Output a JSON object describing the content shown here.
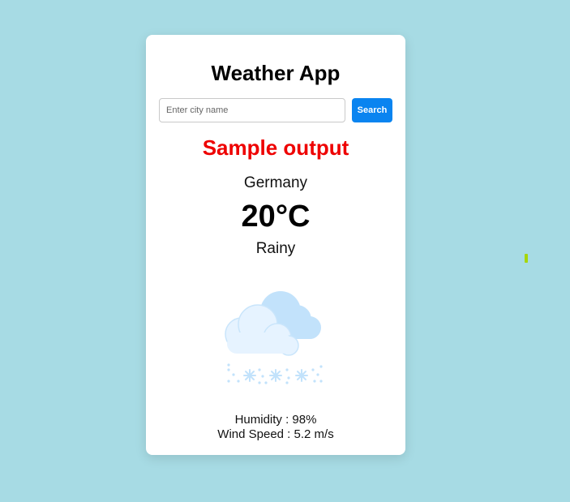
{
  "app": {
    "title": "Weather App"
  },
  "search": {
    "placeholder": "Enter city name",
    "value": "",
    "button_label": "Search"
  },
  "result": {
    "banner": "Sample output",
    "city": "Germany",
    "temperature": "20°C",
    "condition": "Rainy",
    "icon": "cloud-snow-icon",
    "humidity_text": "Humidity : 98%",
    "wind_text": "Wind Speed : 5.2 m/s"
  },
  "colors": {
    "background": "#a7dbe4",
    "card": "#ffffff",
    "accent": "#0a84f0",
    "banner": "#ee0000",
    "cloud_light": "#e6f3ff",
    "cloud_dark": "#c2e2fb"
  }
}
